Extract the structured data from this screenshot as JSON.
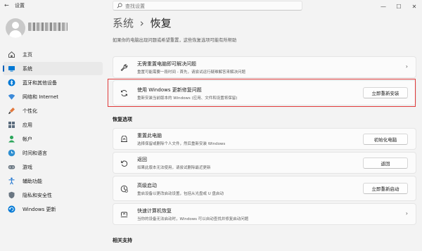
{
  "window": {
    "app_title": "设置",
    "back_icon": "back-arrow-icon",
    "controls": [
      "—",
      "☐",
      "✕"
    ]
  },
  "search": {
    "placeholder": "查找设置"
  },
  "breadcrumb": {
    "parent": "系统",
    "separator": "›",
    "current": "恢复"
  },
  "page_description": "如果你的电脑出现问题或希望重置，这些恢复选项可能有所帮助",
  "sidebar": {
    "items": [
      {
        "label": "主页",
        "icon": "home-icon",
        "active": false
      },
      {
        "label": "系统",
        "icon": "system-icon",
        "active": true
      },
      {
        "label": "蓝牙和其他设备",
        "icon": "bluetooth-icon",
        "active": false
      },
      {
        "label": "网络和 Internet",
        "icon": "wifi-icon",
        "active": false
      },
      {
        "label": "个性化",
        "icon": "paintbrush-icon",
        "active": false
      },
      {
        "label": "应用",
        "icon": "apps-icon",
        "active": false
      },
      {
        "label": "帐户",
        "icon": "account-icon",
        "active": false
      },
      {
        "label": "时间和语言",
        "icon": "globe-clock-icon",
        "active": false
      },
      {
        "label": "游戏",
        "icon": "gamepad-icon",
        "active": false
      },
      {
        "label": "辅助功能",
        "icon": "accessibility-icon",
        "active": false
      },
      {
        "label": "隐私和安全性",
        "icon": "shield-icon",
        "active": false
      },
      {
        "label": "Windows 更新",
        "icon": "update-icon",
        "active": false
      }
    ]
  },
  "cards": {
    "troubleshoot": {
      "title": "无需重置电脑即可解决问题",
      "desc": "重置可能需要一段时间 - 首先，请尝试运行疑难解答来解决问题",
      "icon": "wrench-icon"
    },
    "reinstall": {
      "title": "使用 Windows 更新修复问题",
      "desc": "重新安装当前版本的 Windows (应用、文件和设置将保留)",
      "button": "立即重新安装",
      "icon": "refresh-icon"
    }
  },
  "recovery_section": {
    "title": "恢复选项",
    "items": [
      {
        "title": "重置此电脑",
        "desc": "选择保留或删除个人文件，然后重新安装 Windows",
        "button": "初始化电脑",
        "icon": "reset-pc-icon"
      },
      {
        "title": "返回",
        "desc": "如果此版本无法使用，请尝试删除最近更新",
        "button": "返回",
        "icon": "history-icon"
      },
      {
        "title": "高级启动",
        "desc": "重启设备以更改启动设置，包括从光盘或 U 盘启动",
        "button": "立即重新启动",
        "icon": "advanced-startup-icon"
      },
      {
        "title": "快速计算机恢复",
        "desc": "当你的设备无法启动时，Windows 可以自动查找并修复启动问题",
        "icon": "quick-recovery-icon"
      }
    ]
  },
  "related_section": {
    "title": "相关支持"
  },
  "colors": {
    "accent": "#005fb8",
    "highlight_border": "#e03a3a",
    "background": "#f3f3f3",
    "card": "#fbfbfb"
  }
}
